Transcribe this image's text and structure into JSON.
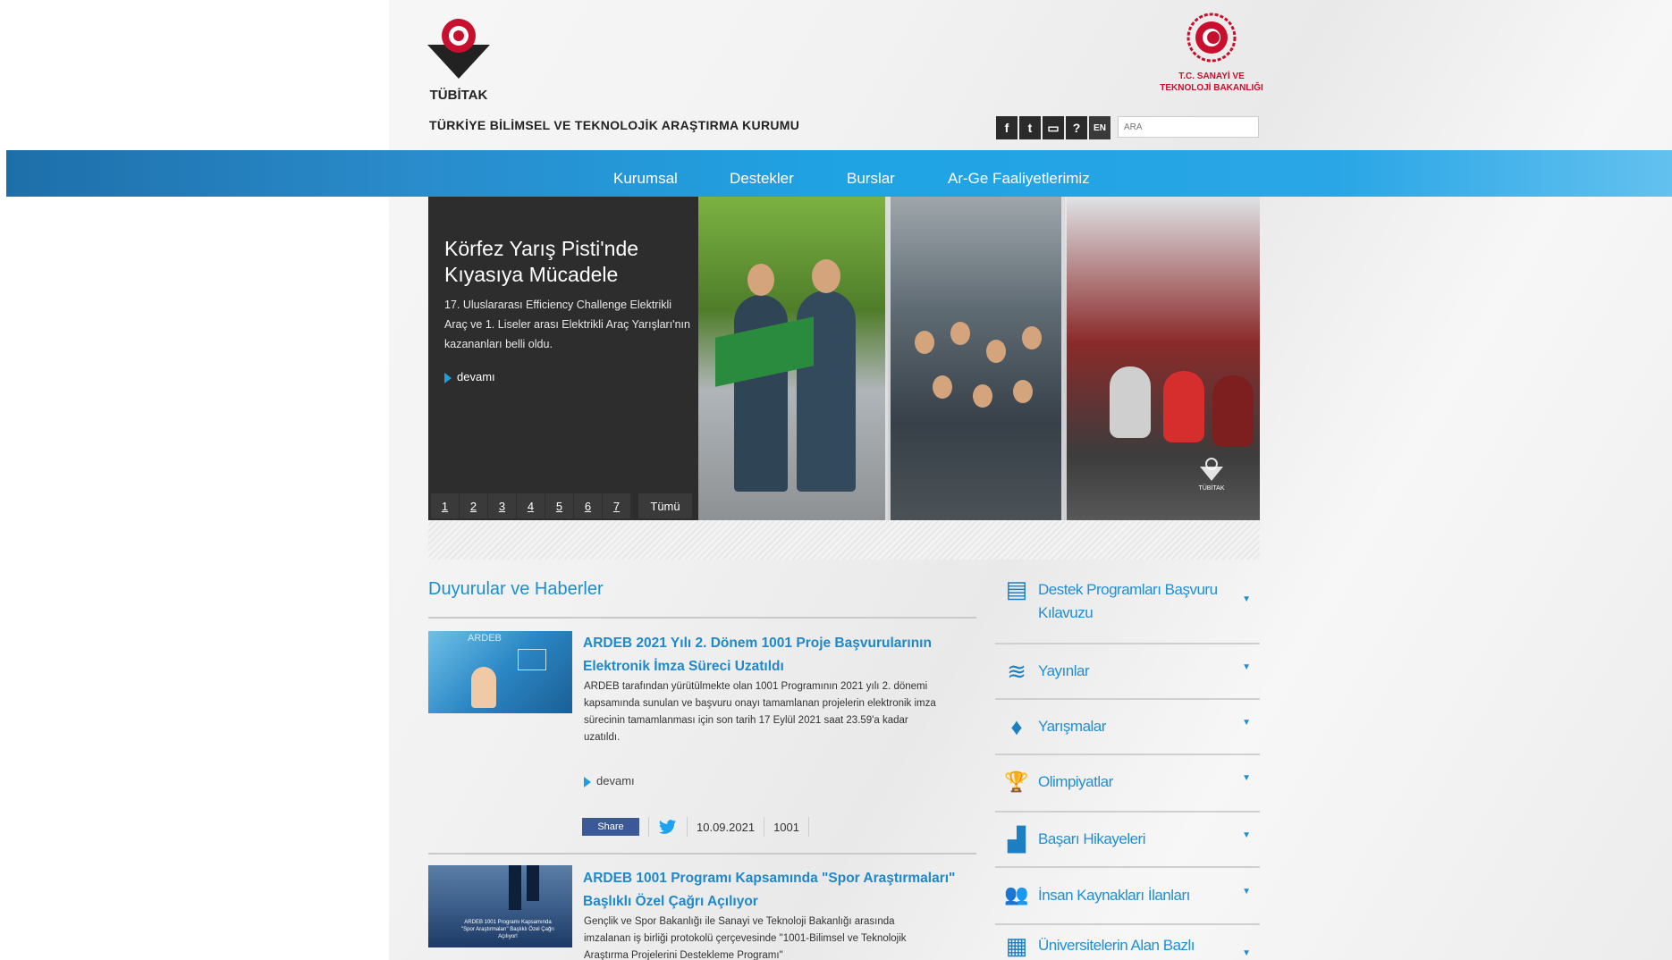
{
  "header": {
    "logo_text": "TÜBİTAK",
    "org_title": "TÜRKİYE BİLİMSEL VE TEKNOLOJİK ARAŞTIRMA KURUMU",
    "ministry_line1": "T.C. SANAYİ VE",
    "ministry_line2": "TEKNOLOJİ BAKANLIĞI",
    "social": {
      "facebook": "f",
      "twitter": "t",
      "book": "▭",
      "help": "?",
      "lang": "EN"
    },
    "search_placeholder": "ARA"
  },
  "nav": {
    "items": [
      {
        "label": "Kurumsal"
      },
      {
        "label": "Destekler"
      },
      {
        "label": "Burslar"
      },
      {
        "label": "Ar-Ge Faaliyetlerimiz"
      }
    ]
  },
  "slider": {
    "title": "Körfez Yarış Pisti'nde Kıyasıya Mücadele",
    "description": "17. Uluslararası Efficiency Challenge Elektrikli Araç ve 1. Liseler arası Elektrikli Araç Yarışları'nın kazananları belli oldu.",
    "more": "devamı",
    "pages": [
      "1",
      "2",
      "3",
      "4",
      "5",
      "6",
      "7"
    ],
    "all_label": "Tümü",
    "watermark": "TÜBİTAK"
  },
  "news": {
    "heading": "Duyurular ve Haberler",
    "items": [
      {
        "title": "ARDEB 2021 Yılı 2. Dönem 1001 Proje Başvurularının Elektronik İmza Süreci Uzatıldı",
        "body": "ARDEB tarafından yürütülmekte olan 1001 Programının 2021 yılı 2. dönemi kapsamında sunulan ve başvuru onayı tamamlanan projelerin elektronik imza sürecinin tamamlanması için son tarih 17 Eylül 2021 saat 23.59'a kadar uzatıldı.",
        "more": "devamı",
        "share": "Share",
        "date": "10.09.2021",
        "tag": "1001",
        "thumb_text": "ARDEB"
      },
      {
        "title": "ARDEB 1001 Programı Kapsamında \"Spor Araştırmaları\" Başlıklı Özel Çağrı Açılıyor",
        "body": "Gençlik ve Spor Bakanlığı ile Sanayi ve Teknoloji Bakanlığı arasında imzalanan iş birliği protokolü çerçevesinde \"1001-Bilimsel ve Teknolojik Araştırma Projelerini Destekleme Programı\"",
        "thumb_text": "ARDEB 1001 Programı Kapsamında \"Spor Araştırmaları\" Başlıklı Özel Çağrı Açılıyor!"
      }
    ]
  },
  "sidebar": {
    "items": [
      {
        "label": "Destek Programları Başvuru Kılavuzu",
        "icon": "guide-book-icon",
        "glyph": "▤"
      },
      {
        "label": "Yayınlar",
        "icon": "layers-icon",
        "glyph": "≋"
      },
      {
        "label": "Yarışmalar",
        "icon": "medal-icon",
        "glyph": "♦"
      },
      {
        "label": "Olimpiyatlar",
        "icon": "trophy-icon",
        "glyph": "🏆"
      },
      {
        "label": "Başarı Hikayeleri",
        "icon": "bar-chart-icon",
        "glyph": "▟"
      },
      {
        "label": "İnsan Kaynakları İlanları",
        "icon": "people-icon",
        "glyph": "👥"
      },
      {
        "label": "Üniversitelerin Alan Bazlı",
        "icon": "search-document-icon",
        "glyph": "▦"
      }
    ],
    "arrow": "▼"
  },
  "colors": {
    "accent": "#1f8fd4",
    "nav": "#2aa6e6",
    "brand_red": "#c8102e"
  }
}
